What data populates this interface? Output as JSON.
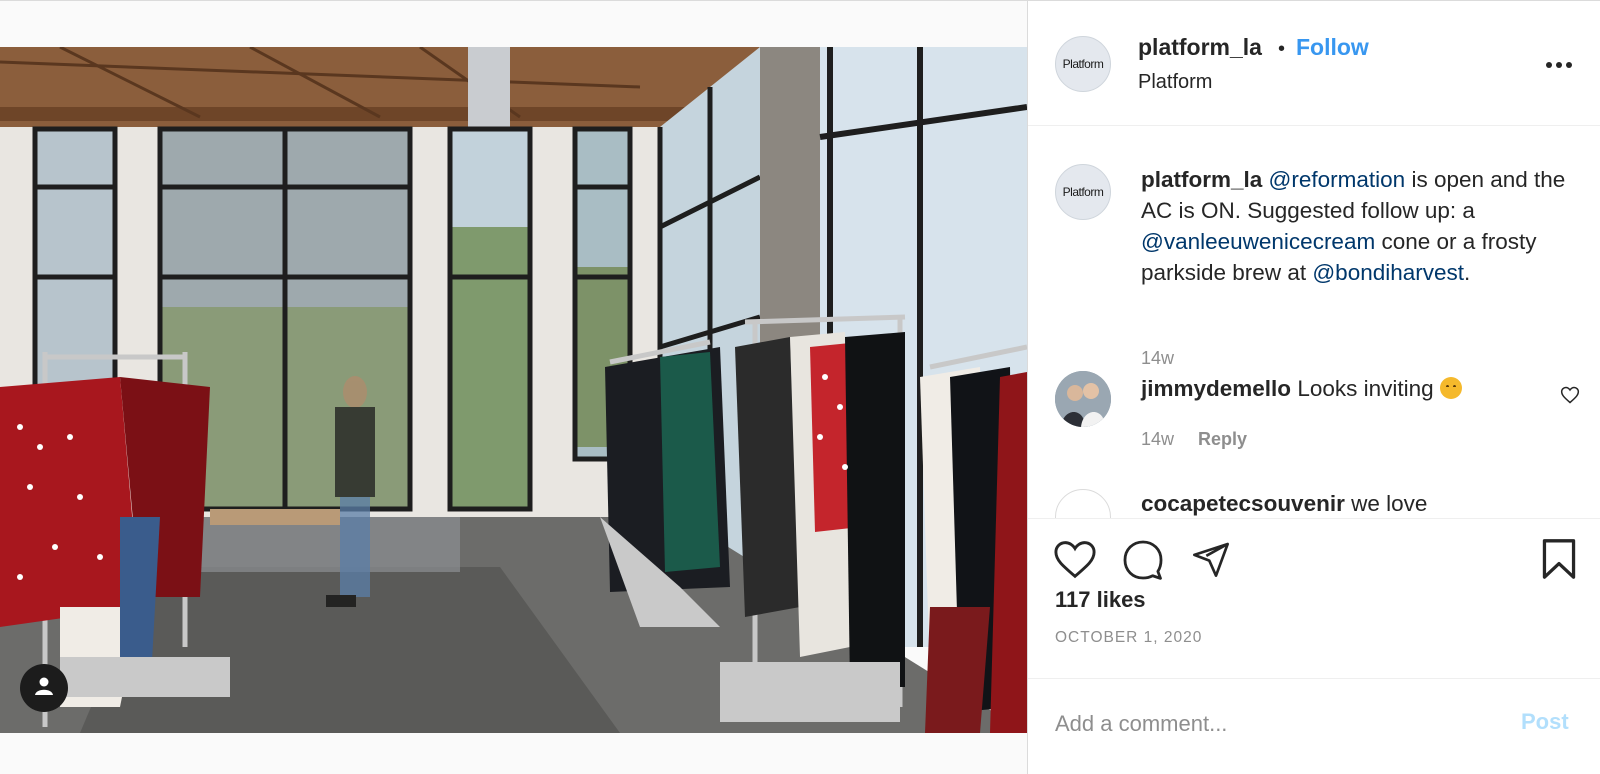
{
  "post": {
    "image_alt": "Clothing store interior with racks of garments and large windows",
    "tag_icon": "user-icon"
  },
  "header": {
    "avatar_text": "Platform",
    "username": "platform_la",
    "separator": "•",
    "follow_label": "Follow",
    "subtitle": "Platform",
    "more_icon": "more-horizontal-icon"
  },
  "caption": {
    "avatar_text": "Platform",
    "username": "platform_la",
    "mention1": "@reformation",
    "text1": " is open and the AC is ON. Suggested follow up: a ",
    "mention2": "@vanleeuwenicecream",
    "text2": " cone or a frosty parkside brew at ",
    "mention3": "@bondiharvest",
    "text3": ".",
    "timestamp": "14w"
  },
  "comments": [
    {
      "username": "jimmydemello",
      "text": "Looks inviting",
      "emoji": "hugging-face",
      "timestamp": "14w",
      "reply_label": "Reply",
      "like_icon": "heart-icon"
    },
    {
      "username": "cocapetecsouvenir",
      "text": "we love"
    }
  ],
  "actions": {
    "like_icon": "heart-icon",
    "comment_icon": "comment-icon",
    "share_icon": "paper-plane-icon",
    "save_icon": "bookmark-icon",
    "likes": "117 likes",
    "date": "OCTOBER 1, 2020"
  },
  "add_comment": {
    "placeholder": "Add a comment...",
    "post_label": "Post"
  },
  "colors": {
    "link_blue": "#3897f0",
    "mention": "#00376b",
    "muted": "#8e8e8e",
    "post_disabled": "#b2dffc"
  }
}
